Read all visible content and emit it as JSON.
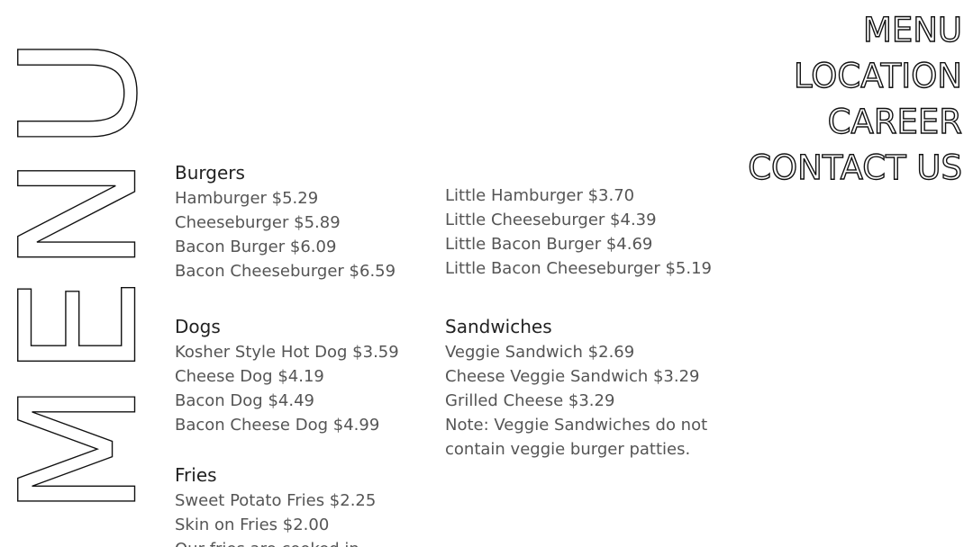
{
  "side_title": "MENU",
  "nav": {
    "items": [
      {
        "label": "MENU"
      },
      {
        "label": "LOCATION"
      },
      {
        "label": "CAREER"
      },
      {
        "label": "CONTACT US"
      }
    ]
  },
  "burgers": {
    "title": "Burgers",
    "items": [
      "Hamburger $5.29",
      "Cheeseburger $5.89",
      "Bacon Burger $6.09",
      "Bacon Cheeseburger $6.59"
    ]
  },
  "little_burgers": {
    "items": [
      "Little Hamburger $3.70",
      "Little Cheeseburger $4.39",
      "Little Bacon Burger $4.69",
      "Little Bacon Cheeseburger $5.19"
    ]
  },
  "dogs": {
    "title": "Dogs",
    "items": [
      "Kosher Style Hot Dog $3.59",
      "Cheese Dog $4.19",
      "Bacon Dog $4.49",
      "Bacon Cheese Dog $4.99"
    ]
  },
  "sandwiches": {
    "title": "Sandwiches",
    "items": [
      "Veggie Sandwich $2.69",
      "Cheese Veggie Sandwich $3.29",
      "Grilled Cheese $3.29"
    ],
    "note": "Note: Veggie Sandwiches do not contain veggie burger patties."
  },
  "fries": {
    "title": "Fries",
    "items": [
      "Sweet Potato Fries $2.25",
      "Skin on Fries $2.00",
      "Our fries are cooked in"
    ]
  }
}
